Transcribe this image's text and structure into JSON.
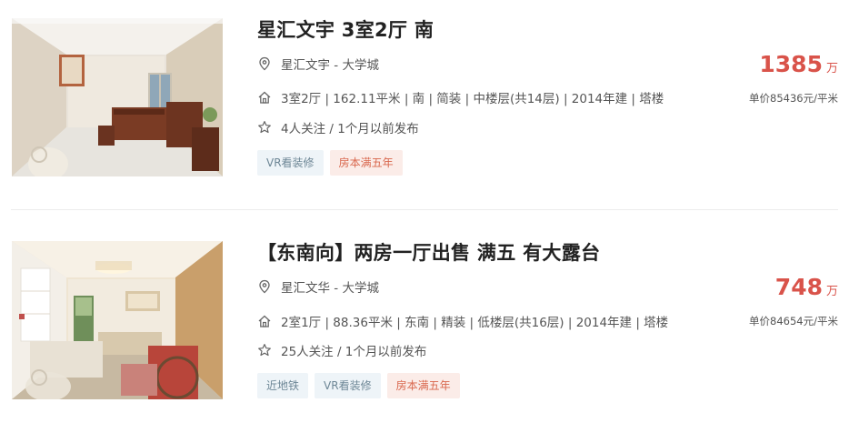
{
  "listings": [
    {
      "title": "星汇文宇 3室2厅 南",
      "community": "星汇文宇 - 大学城",
      "details": "3室2厅 | 162.11平米 | 南 | 简装 | 中楼层(共14层) | 2014年建 | 塔楼",
      "followers": "4人关注 / 1个月以前发布",
      "tags": [
        {
          "label": "VR看装修",
          "style": "blue"
        },
        {
          "label": "房本满五年",
          "style": "red"
        }
      ],
      "total_price": "1385",
      "total_unit": "万",
      "unit_price": "单价85436元/平米"
    },
    {
      "title": "【东南向】两房一厅出售 满五 有大露台",
      "community": "星汇文华 - 大学城",
      "details": "2室1厅 | 88.36平米 | 东南 | 精装 | 低楼层(共16层) | 2014年建 | 塔楼",
      "followers": "25人关注 / 1个月以前发布",
      "tags": [
        {
          "label": "近地铁",
          "style": "blue"
        },
        {
          "label": "VR看装修",
          "style": "blue"
        },
        {
          "label": "房本满五年",
          "style": "red"
        }
      ],
      "total_price": "748",
      "total_unit": "万",
      "unit_price": "单价84654元/平米"
    }
  ],
  "icons": {
    "location": "location-pin-icon",
    "house": "house-icon",
    "star": "star-icon"
  },
  "colors": {
    "price": "#d9534a",
    "tag_blue_bg": "#eef4f8",
    "tag_red_bg": "#fbece8"
  }
}
